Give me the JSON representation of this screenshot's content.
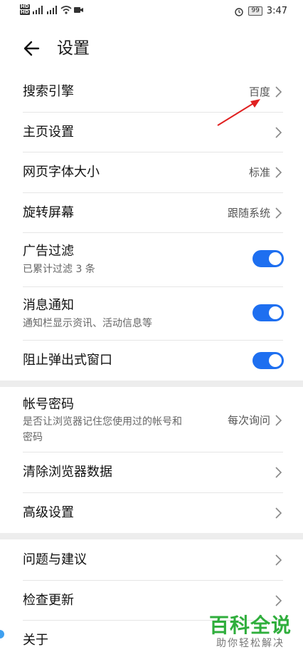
{
  "status_bar": {
    "hd_top": "HD",
    "hd_bottom": "HD",
    "net1": "4G",
    "net2": "4G",
    "battery": "99",
    "time": "3:47"
  },
  "header": {
    "title": "设置",
    "back_icon": "back-arrow-icon"
  },
  "rows": {
    "search_engine": {
      "label": "搜索引擎",
      "value": "百度"
    },
    "homepage": {
      "label": "主页设置"
    },
    "font_size": {
      "label": "网页字体大小",
      "value": "标准"
    },
    "rotate": {
      "label": "旋转屏幕",
      "value": "跟随系统"
    },
    "ad_filter": {
      "label": "广告过滤",
      "sub": "已累计过滤 3 条",
      "on": true
    },
    "notify": {
      "label": "消息通知",
      "sub": "通知栏显示资讯、活动信息等",
      "on": true
    },
    "popup_block": {
      "label": "阻止弹出式窗口",
      "on": true
    },
    "account_pwd": {
      "label": "帐号密码",
      "sub_line1": "是否让浏览器记住您使用过的帐号和",
      "sub_line2": "密码",
      "value": "每次询问"
    },
    "clear_data": {
      "label": "清除浏览器数据"
    },
    "advanced": {
      "label": "高级设置"
    },
    "feedback": {
      "label": "问题与建议"
    },
    "update": {
      "label": "检查更新"
    },
    "about": {
      "label": "关于"
    }
  },
  "watermark": {
    "title": "百科全说",
    "sub": "助你轻松解决"
  },
  "colors": {
    "accent": "#1e6ff0",
    "annotation": "#e02020",
    "watermark": "#2fae3c"
  }
}
